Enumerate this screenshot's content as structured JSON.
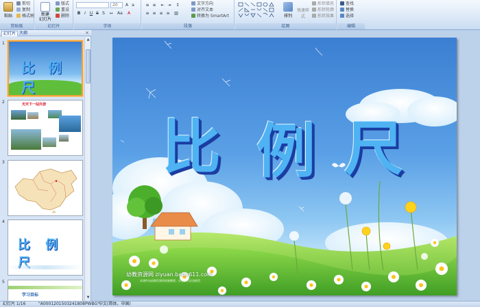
{
  "ribbon": {
    "clipboard": {
      "paste": "粘贴",
      "cut": "剪切",
      "copy": "复制",
      "format_painter": "格式刷",
      "label": "剪贴板"
    },
    "slides": {
      "new_slide": "新建\n幻灯片",
      "layout": "版式",
      "reset": "重设",
      "delete": "删除",
      "label": "幻灯片"
    },
    "font": {
      "font_size": "20",
      "label": "字体"
    },
    "paragraph": {
      "text_direction": "文字方向",
      "align_text": "对齐文本",
      "smartart": "转换为 SmartArt",
      "label": "段落"
    },
    "drawing": {
      "arrange": "排列",
      "quick_styles": "快速样式",
      "shape_fill": "形状填充",
      "shape_outline": "形状轮廓",
      "shape_effects": "形状效果",
      "label": "绘图"
    },
    "editing": {
      "find": "查找",
      "replace": "替换",
      "select": "选择",
      "label": "编辑"
    }
  },
  "panel": {
    "tabs": [
      "幻灯片",
      "大纲"
    ],
    "close": "×",
    "thumbnails": [
      {
        "num": "1",
        "title": "比 例 尺"
      },
      {
        "num": "2",
        "title": "天天下一站外游"
      },
      {
        "num": "3",
        "title": ""
      },
      {
        "num": "4",
        "title": "比 例 尺"
      },
      {
        "num": "5",
        "title": "学习目标"
      }
    ]
  },
  "slide": {
    "title_chars": [
      "比",
      "例",
      "尺"
    ],
    "watermark": "幼教资源网 ziyuan.baby611.com",
    "watermark_sub": "本课件由幼教资源网收集整理，仅供学习交流使用"
  },
  "status": {
    "slide_info": "幻灯片 1/16",
    "template": "\"A0001201503241808PWBG\"",
    "language": "中文(简体，中国)"
  },
  "colors": {
    "accent": "#4fb2f2",
    "ribbon": "#dbe8f7",
    "selection": "#f3a23c"
  }
}
